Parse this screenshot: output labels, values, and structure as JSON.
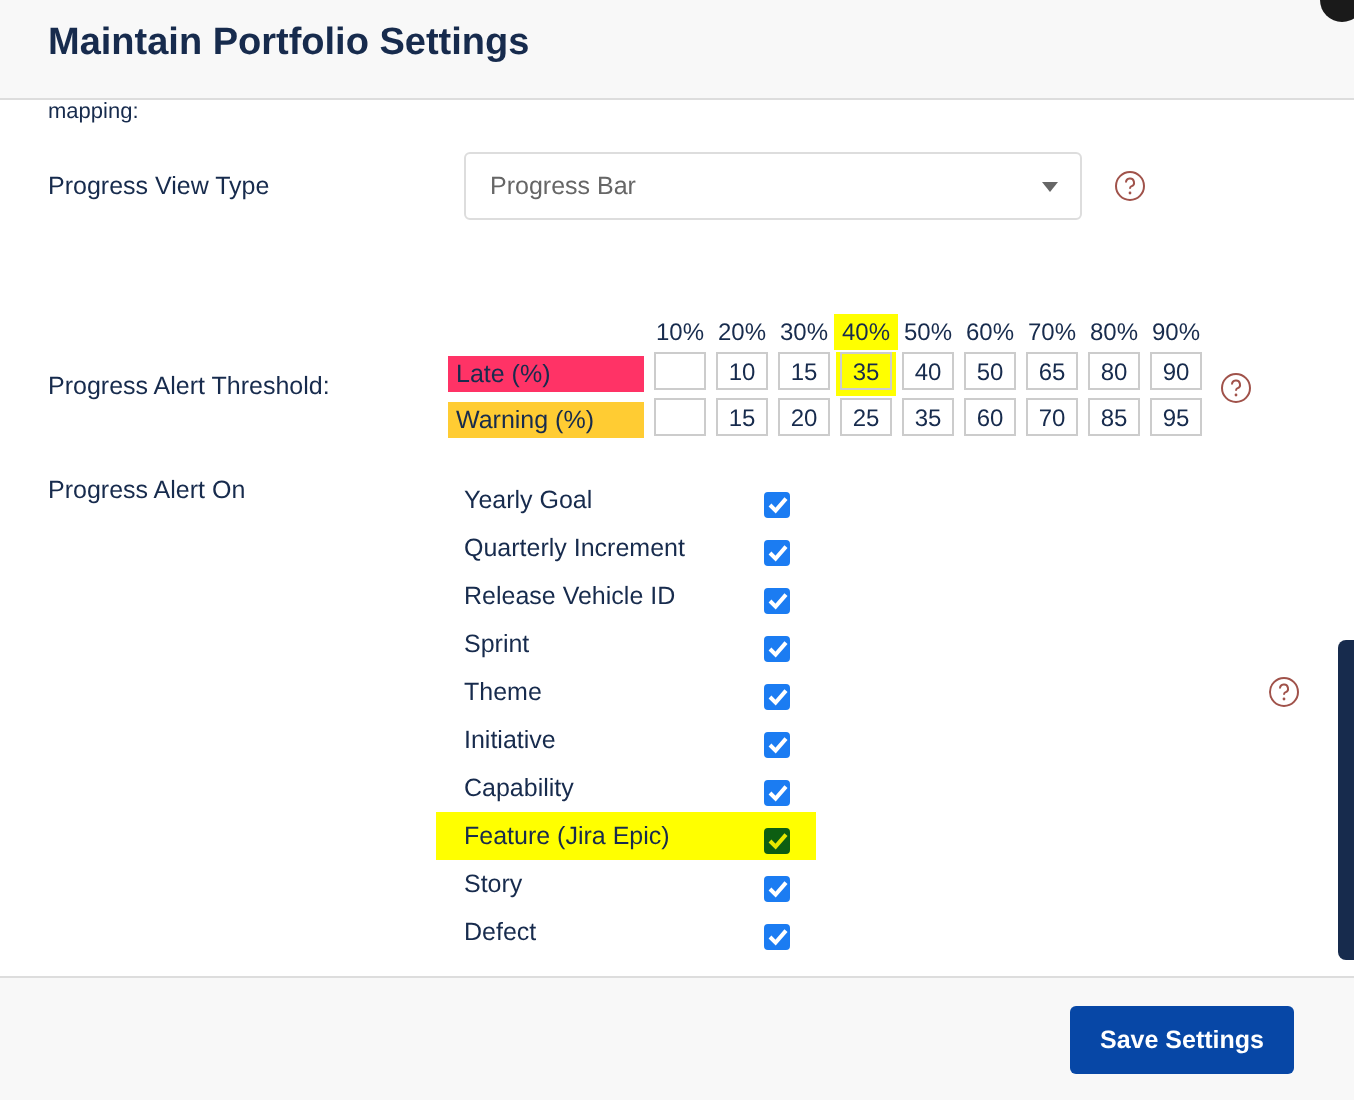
{
  "dialog": {
    "title": "Maintain Portfolio Settings"
  },
  "mapping_row": {
    "label": "mapping:"
  },
  "view_type": {
    "label": "Progress View Type",
    "value": "Progress Bar"
  },
  "threshold": {
    "label": "Progress Alert Threshold:",
    "columns": [
      {
        "header": "10%",
        "highlighted": false
      },
      {
        "header": "20%",
        "highlighted": false
      },
      {
        "header": "30%",
        "highlighted": false
      },
      {
        "header": "40%",
        "highlighted": true
      },
      {
        "header": "50%",
        "highlighted": false
      },
      {
        "header": "60%",
        "highlighted": false
      },
      {
        "header": "70%",
        "highlighted": false
      },
      {
        "header": "80%",
        "highlighted": false
      },
      {
        "header": "90%",
        "highlighted": false
      }
    ],
    "rows": [
      {
        "label": "Late (%)",
        "color": "#ff3366",
        "cells": [
          {},
          {
            "value": "10"
          },
          {
            "value": "15"
          },
          {
            "value": "35"
          },
          {
            "value": "40"
          },
          {
            "value": "50"
          },
          {
            "value": "65"
          },
          {
            "value": "80"
          },
          {
            "value": "90"
          }
        ]
      },
      {
        "label": "Warning (%)",
        "color": "#ffcc33",
        "cells": [
          {},
          {
            "value": "15"
          },
          {
            "value": "20"
          },
          {
            "value": "25"
          },
          {
            "value": "35"
          },
          {
            "value": "60"
          },
          {
            "value": "70"
          },
          {
            "value": "85"
          },
          {
            "value": "95"
          }
        ]
      }
    ]
  },
  "alert_on": {
    "label": "Progress Alert On",
    "items": [
      {
        "label": "Yearly Goal",
        "checked": true,
        "highlighted": false
      },
      {
        "label": "Quarterly Increment",
        "checked": true,
        "highlighted": false
      },
      {
        "label": "Release Vehicle ID",
        "checked": true,
        "highlighted": false
      },
      {
        "label": "Sprint",
        "checked": true,
        "highlighted": false
      },
      {
        "label": "Theme",
        "checked": true,
        "highlighted": false
      },
      {
        "label": "Initiative",
        "checked": true,
        "highlighted": false
      },
      {
        "label": "Capability",
        "checked": true,
        "highlighted": false
      },
      {
        "label": "Feature (Jira Epic)",
        "checked": true,
        "highlighted": true
      },
      {
        "label": "Story",
        "checked": true,
        "highlighted": false
      },
      {
        "label": "Defect",
        "checked": true,
        "highlighted": false
      }
    ]
  },
  "footer": {
    "button": "Save Settings"
  }
}
